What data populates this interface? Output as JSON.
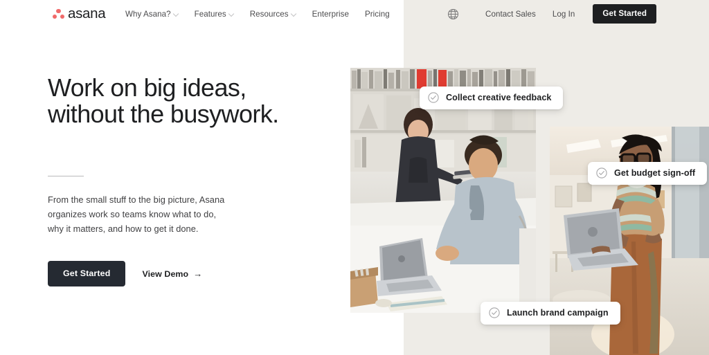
{
  "brand": {
    "logo_word": "asana",
    "logo_dot_color": "#f06a6a",
    "logo_text_color": "#1e1f21"
  },
  "nav": {
    "items": [
      {
        "label": "Why Asana?",
        "has_dropdown": true
      },
      {
        "label": "Features",
        "has_dropdown": true
      },
      {
        "label": "Resources",
        "has_dropdown": true
      },
      {
        "label": "Enterprise",
        "has_dropdown": false
      },
      {
        "label": "Pricing",
        "has_dropdown": false
      }
    ],
    "language_icon": "globe-icon",
    "contact_sales": "Contact Sales",
    "log_in": "Log In",
    "get_started": "Get Started",
    "get_started_bg": "#1e1f21"
  },
  "hero": {
    "headline": "Work on big ideas,\nwithout the busywork.",
    "subcopy": "From the small stuff to the big picture, Asana\norganizes work so teams know what to do,\nwhy it matters, and how to get it done.",
    "primary_cta": "Get Started",
    "primary_cta_bg": "#252a32",
    "secondary_cta": "View Demo",
    "secondary_cta_arrow": "→"
  },
  "media": {
    "background_panel_color": "#eeece7",
    "photos": [
      {
        "name": "office-desk-collaboration-photo",
        "alt": "Two colleagues working at a white desk with a laptop in a studio office"
      },
      {
        "name": "lobby-woman-laptop-photo",
        "alt": "Woman with glasses holding an open laptop while standing in a bright lobby"
      }
    ],
    "task_pills": [
      {
        "icon": "check-circle-icon",
        "label": "Collect creative feedback"
      },
      {
        "icon": "check-circle-icon",
        "label": "Get budget sign-off"
      },
      {
        "icon": "check-circle-icon",
        "label": "Launch brand campaign"
      }
    ]
  }
}
